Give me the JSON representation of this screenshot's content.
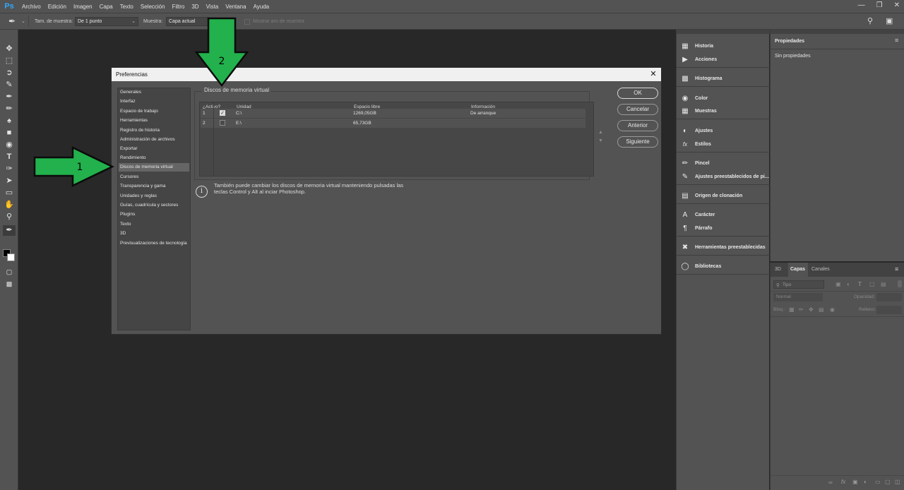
{
  "app": {
    "logo": "Ps",
    "menu": [
      "Archivo",
      "Edición",
      "Imagen",
      "Capa",
      "Texto",
      "Selección",
      "Filtro",
      "3D",
      "Vista",
      "Ventana",
      "Ayuda"
    ]
  },
  "options_bar": {
    "sample_size_label": "Tam. de muestra:",
    "sample_size_value": "De 1 punto",
    "sample_label": "Muestra:",
    "sample_value": "Capa actual",
    "show_ring_label": "Mostrar aro de muestra"
  },
  "dock": {
    "items": [
      {
        "label": "Historia",
        "icon": "history-icon"
      },
      {
        "label": "Acciones",
        "icon": "play-icon"
      },
      {
        "label": "Histograma",
        "icon": "histogram-icon"
      },
      {
        "label": "Color",
        "icon": "palette-icon"
      },
      {
        "label": "Muestras",
        "icon": "grid-icon"
      },
      {
        "label": "Ajustes",
        "icon": "adjustments-icon"
      },
      {
        "label": "Estilos",
        "icon": "fx-icon"
      },
      {
        "label": "Pincel",
        "icon": "brush-icon"
      },
      {
        "label": "Ajustes preestablecidos de pi...",
        "icon": "brush-presets-icon"
      },
      {
        "label": "Origen de clonación",
        "icon": "clone-source-icon"
      },
      {
        "label": "Carácter",
        "icon": "character-icon"
      },
      {
        "label": "Párrafo",
        "icon": "paragraph-icon"
      },
      {
        "label": "Herramientas preestablecidas",
        "icon": "tool-presets-icon"
      },
      {
        "label": "Bibliotecas",
        "icon": "libraries-icon"
      }
    ]
  },
  "properties": {
    "tab": "Propiedades",
    "empty": "Sin propiedades"
  },
  "layers": {
    "tabs": [
      "3D",
      "Capas",
      "Canales"
    ],
    "active_tab": "Capas",
    "filter_placeholder": "Tipo",
    "blend_mode": "Normal",
    "opacity_label": "Opacidad:",
    "lock_label": "Bloq.:",
    "fill_label": "Relleno:"
  },
  "dialog": {
    "title": "Preferencias",
    "nav": [
      "Generales",
      "Interfaz",
      "Espacio de trabajo",
      "Herramientas",
      "Registro de historia",
      "Administración de archivos",
      "Exportar",
      "Rendimiento",
      "Discos de memoria virtual",
      "Cursores",
      "Transparencia y gama",
      "Unidades y reglas",
      "Guías, cuadrícula y sectores",
      "Plugins",
      "Texto",
      "3D",
      "Previsualizaciones de tecnología"
    ],
    "selected_nav": "Discos de memoria virtual",
    "group_title": "Discos de memoria virtual",
    "table": {
      "headers": [
        "¿Activo?",
        "Unidad",
        "Espacio libre",
        "Información"
      ],
      "rows": [
        {
          "num": "1",
          "active": true,
          "unit": "C:\\",
          "free": "1269,05GB",
          "info": "De arranque"
        },
        {
          "num": "2",
          "active": false,
          "unit": "E:\\",
          "free": "65,73GB",
          "info": ""
        }
      ]
    },
    "buttons": {
      "ok": "OK",
      "cancel": "Cancelar",
      "prev": "Anterior",
      "next": "Siguiente"
    },
    "info_line1": "También puede cambiar los discos de memoria virtual manteniendo pulsadas las",
    "info_line2": "teclas Control y Alt al inciar Photoshop."
  },
  "annotations": {
    "arrow1": "1",
    "arrow2": "2",
    "color": "#22b14c"
  }
}
